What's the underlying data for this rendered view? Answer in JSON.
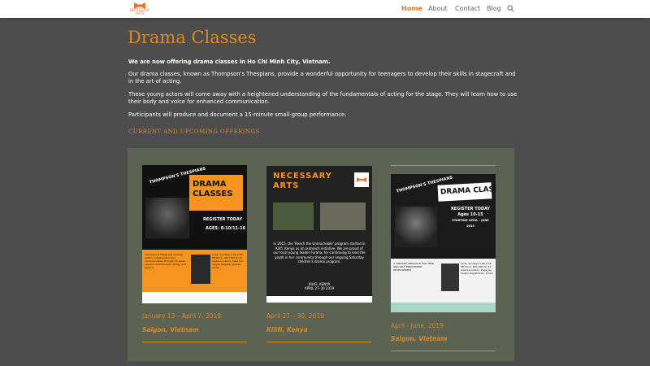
{
  "header": {
    "logo_text": "NECESSARY ARTS",
    "nav": [
      "Home",
      "About",
      "Contact",
      "Blog"
    ],
    "active": "Home"
  },
  "page": {
    "title": "Drama Classes",
    "intro_bold": "We are now offering drama classes in Ho Chi Minh City, Vietnam.",
    "para1": "Our drama classes, known as Thompson's Thespians, provide a wonderful opportunity for teenagers to develop their skills in stagecraft and in the art of acting.",
    "para2": "These young actors will come away with a heightened understanding of the fundamentals of acting for the stage. They will learn how to use their body and voice for enhanced communication.",
    "para3": "Participants will produce and document a 15-minute small-group performance.",
    "offerings_heading": "CURRENT AND UPCOMING OFFERINGS"
  },
  "offerings": [
    {
      "date": "January 13 – April 7, 2019",
      "location": "Saigon, Vietnam",
      "poster": {
        "tag": "THOMPSON'S THESPIANS",
        "title_line1": "DRAMA",
        "title_line2": "CLASSES",
        "register": "REGISTER TODAY",
        "ages": "AGES: 8-10/11-16",
        "band_text": "Thompson's Thespians develop skills in collaboration and communication through 12-week sessions of immersive acting, and speech.",
        "band_info": "Time: Sundays 1:00-2:30 PM  Price: 300 USD for 12 weeks  Location: Papa Joe Saigon  Register: please email"
      }
    },
    {
      "date": "April 27 – 30, 2019",
      "location": "Kilifi, Kenya",
      "poster": {
        "title_line1": "NECESSARY",
        "title_line2": "ARTS",
        "body": "In 2015, the 'Reach the Unreachable' program started in Kilifi, Kenya as an outreach initiative. We are proud of our local young leader Furaha, for continuing to lead the youth in her community through our ongoing Saturday children's drama program.",
        "where": "KILIFI, KENYA",
        "when": "APRIL 27–30 2019"
      }
    },
    {
      "date": "April - June, 2019",
      "location": "Saigon, Vietnam",
      "poster": {
        "tag": "THOMPSON'S THESPIANS",
        "title": "DRAMA CLASSES",
        "register": "REGISTER TODAY",
        "ages": "Ages 10-15",
        "starting": "STARTING APRIL - JUNE 2019",
        "band_text": "A THEATRE APPROACH FOR TEEN AND SELF ENRICHMENT DEVELOPMENT",
        "band_info": "Time: Sundays 1:00-2:30 PM  Price: 200 USD for 10 weeks  Location: Papa Joe Saigon  Registration: Email"
      }
    }
  ],
  "colors": {
    "accent": "#d98a2a",
    "background": "#4d4d4d",
    "panel": "#5c6352",
    "poster_orange": "#f6941f"
  }
}
